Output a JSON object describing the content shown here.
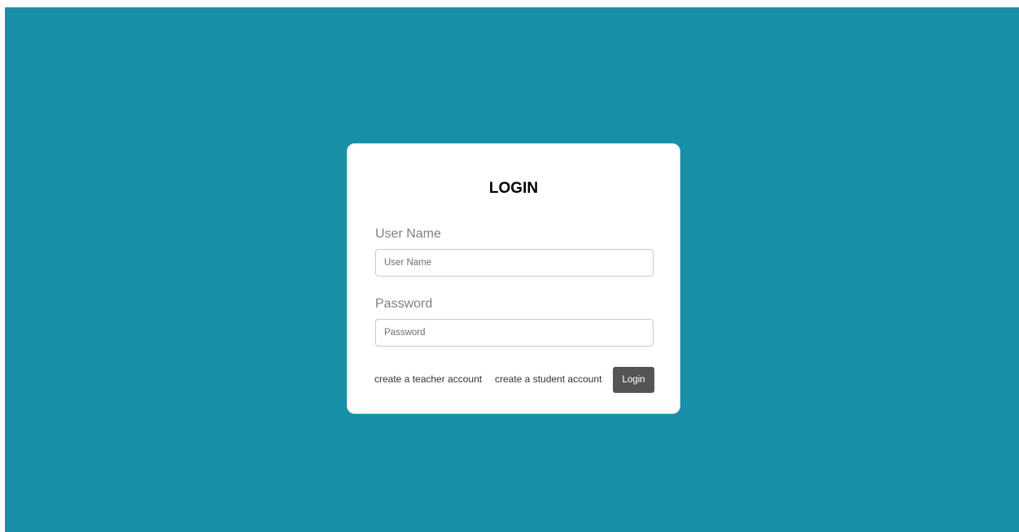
{
  "login_form": {
    "title": "LOGIN",
    "username": {
      "label": "User Name",
      "placeholder": "User Name",
      "value": ""
    },
    "password": {
      "label": "Password",
      "placeholder": "Password",
      "value": ""
    },
    "links": {
      "teacher": "create a teacher account",
      "student": "create a student account"
    },
    "submit_label": "Login"
  },
  "colors": {
    "background": "#1790a8",
    "card": "#ffffff",
    "button": "#555555"
  }
}
